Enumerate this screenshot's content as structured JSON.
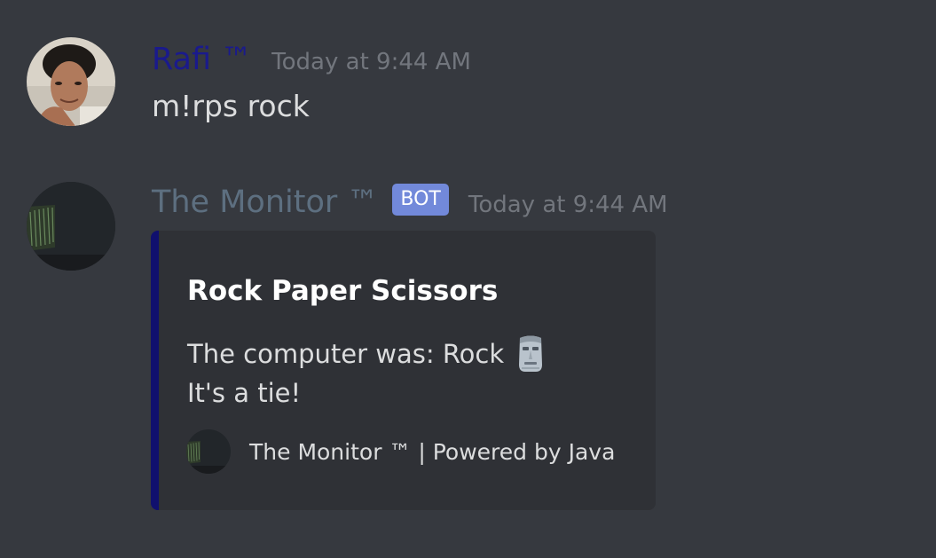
{
  "messages": [
    {
      "author": "Rafi ™",
      "author_color": "#1a1a8c",
      "timestamp": "Today at 9:44 AM",
      "avatar_icon": "user-avatar-photo",
      "content": "m!rps rock"
    },
    {
      "author": "The Monitor ™",
      "author_color": "#5d6f80",
      "badge": "BOT",
      "timestamp": "Today at 9:44 AM",
      "avatar_icon": "bot-avatar-dark-monitor",
      "embed": {
        "accent_color": "#10106e",
        "title": "Rock Paper Scissors",
        "description_line1": "The computer was: Rock",
        "description_emoji": "moai-emoji",
        "description_line2": "It's a tie!",
        "footer_icon": "bot-avatar-dark-monitor",
        "footer_text": "The Monitor ™ | Powered by Java"
      }
    }
  ],
  "theme": {
    "background": "#36393f",
    "embed_background": "#2f3136",
    "timestamp_color": "#72767d",
    "text_color": "#dcddde",
    "badge_color": "#7289da"
  }
}
